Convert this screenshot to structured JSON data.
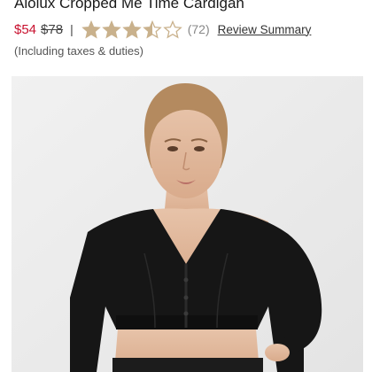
{
  "product": {
    "title": "Alolux Cropped Me Time Cardigan",
    "price_sale": "$54",
    "price_original": "$78",
    "separator": "|",
    "rating": 3.5,
    "rating_max": 5,
    "review_count": "(72)",
    "review_summary_link": "Review Summary",
    "tax_note": "(Including taxes & duties)"
  },
  "colors": {
    "sale_price": "#c8102e",
    "star_filled": "#c9b18c",
    "photo_background": "#ececec",
    "garment": "#161616"
  },
  "image": {
    "icon": "product-photo"
  }
}
